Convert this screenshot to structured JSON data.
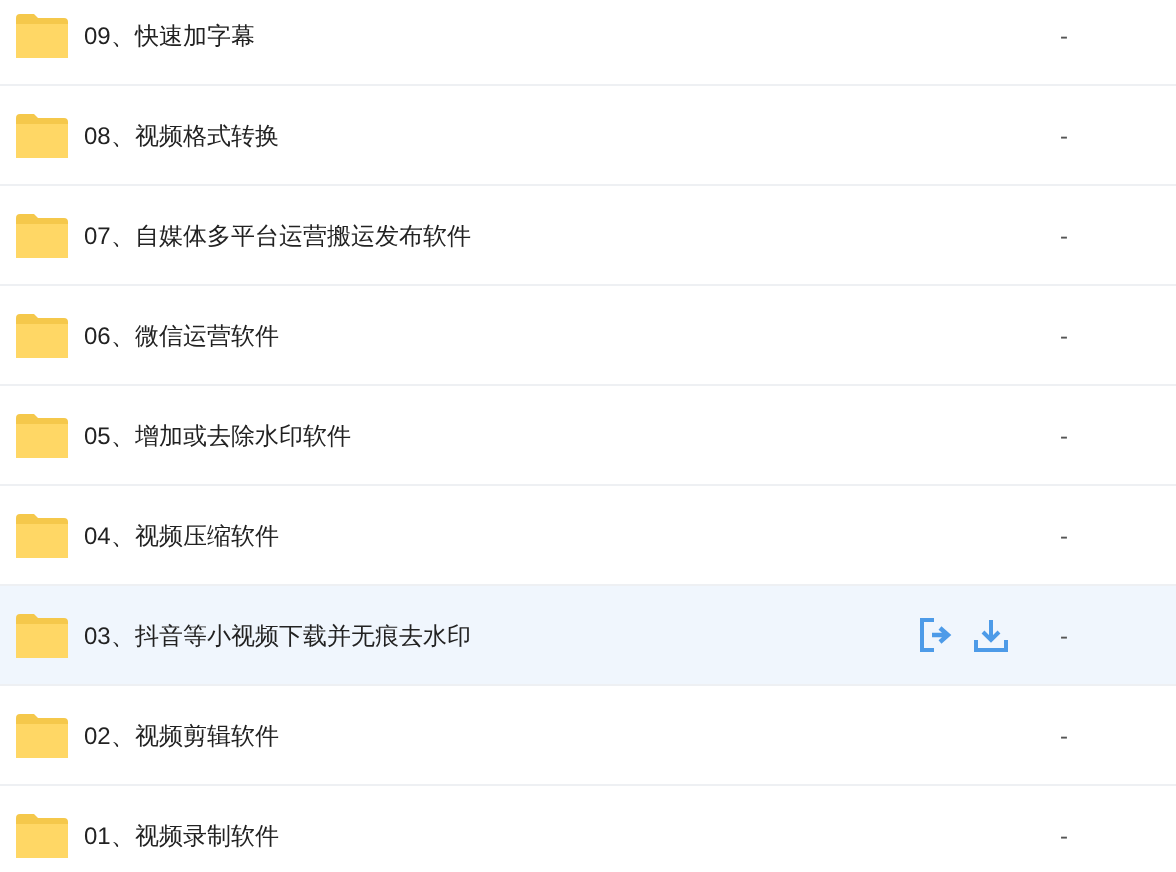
{
  "files": [
    {
      "name": "09、快速加字幕",
      "size": "-",
      "selected": false
    },
    {
      "name": "08、视频格式转换",
      "size": "-",
      "selected": false
    },
    {
      "name": "07、自媒体多平台运营搬运发布软件",
      "size": "-",
      "selected": false
    },
    {
      "name": "06、微信运营软件",
      "size": "-",
      "selected": false
    },
    {
      "name": "05、增加或去除水印软件",
      "size": "-",
      "selected": false
    },
    {
      "name": "04、视频压缩软件",
      "size": "-",
      "selected": false
    },
    {
      "name": "03、抖音等小视频下载并无痕去水印",
      "size": "-",
      "selected": true
    },
    {
      "name": "02、视频剪辑软件",
      "size": "-",
      "selected": false
    },
    {
      "name": "01、视频录制软件",
      "size": "-",
      "selected": false
    }
  ]
}
